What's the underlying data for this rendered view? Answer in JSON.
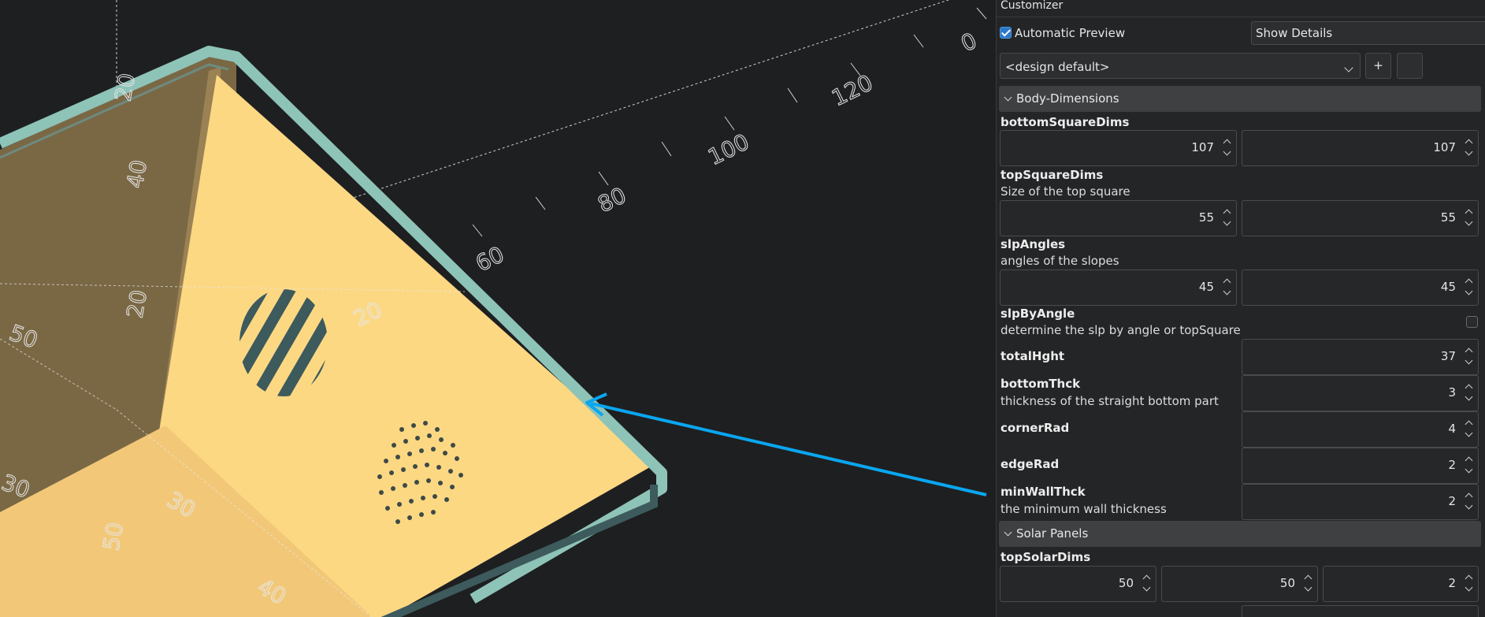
{
  "viewport": {
    "axis_labels": [
      "0",
      "120",
      "100",
      "80",
      "60",
      "20",
      "40",
      "50",
      "20",
      "30",
      "50",
      "40",
      "30",
      "20"
    ]
  },
  "customizer": {
    "title": "Customizer",
    "automatic_preview": {
      "label": "Automatic Preview",
      "checked": true
    },
    "show_details": "Show Details",
    "preset": {
      "selected": "<design default>",
      "add_label": "+"
    },
    "sections": [
      {
        "title": "Body-Dimensions",
        "params": [
          {
            "name": "bottomSquareDims",
            "desc": "",
            "values": [
              "107",
              "107"
            ]
          },
          {
            "name": "topSquareDims",
            "desc": "Size of the top square",
            "values": [
              "55",
              "55"
            ]
          },
          {
            "name": "slpAngles",
            "desc": "angles of the slopes",
            "values": [
              "45",
              "45"
            ]
          },
          {
            "name": "slpByAngle",
            "desc": "determine the slp by angle or topSquare",
            "checked": false
          },
          {
            "name": "totalHght",
            "desc": "",
            "values": [
              "37"
            ]
          },
          {
            "name": "bottomThck",
            "desc": "thickness of the straight bottom part",
            "values": [
              "3"
            ]
          },
          {
            "name": "cornerRad",
            "desc": "",
            "values": [
              "4"
            ]
          },
          {
            "name": "edgeRad",
            "desc": "",
            "values": [
              "2"
            ]
          },
          {
            "name": "minWallThck",
            "desc": "the minimum wall thickness",
            "values": [
              "2"
            ]
          }
        ]
      },
      {
        "title": "Solar Panels",
        "params": [
          {
            "name": "topSolarDims",
            "desc": "",
            "values": [
              "50",
              "50",
              "2"
            ]
          }
        ]
      }
    ]
  },
  "colors": {
    "accent": "#2b78c8",
    "arrow": "#0aa6f0",
    "body": "#fdd883",
    "rim": "#8ec3b8"
  }
}
